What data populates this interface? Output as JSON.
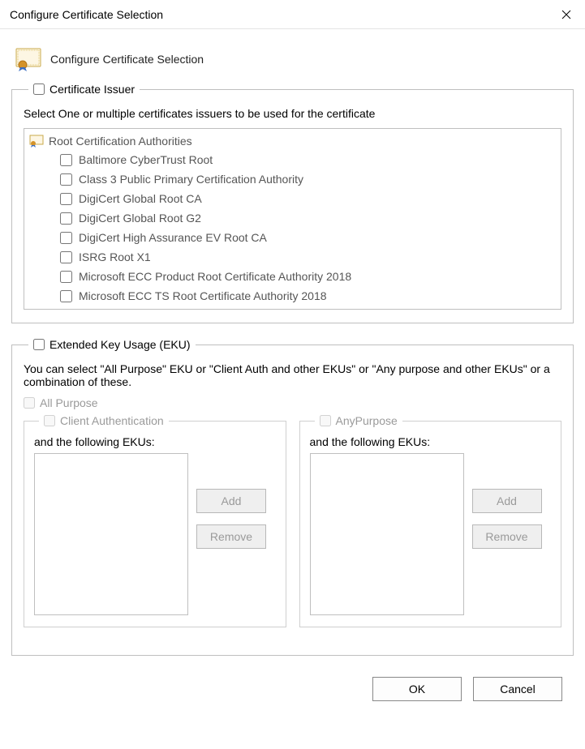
{
  "window": {
    "title": "Configure Certificate Selection"
  },
  "header": {
    "title": "Configure Certificate Selection"
  },
  "issuer": {
    "legend": "Certificate Issuer",
    "desc": "Select One or multiple certificates issuers to be used for the certificate",
    "root_label": "Root Certification Authorities",
    "items": [
      "Baltimore CyberTrust Root",
      "Class 3 Public Primary Certification Authority",
      "DigiCert Global Root CA",
      "DigiCert Global Root G2",
      "DigiCert High Assurance EV Root CA",
      "ISRG Root X1",
      "Microsoft ECC Product Root Certificate Authority 2018",
      "Microsoft ECC TS Root Certificate Authority 2018"
    ]
  },
  "eku": {
    "legend": "Extended Key Usage (EKU)",
    "desc": "You can select \"All Purpose\" EKU or \"Client Auth and other EKUs\" or \"Any purpose and other EKUs\" or a combination of these.",
    "all_purpose": "All Purpose",
    "client_auth": {
      "legend": "Client Authentication",
      "sub": "and the following EKUs:",
      "add": "Add",
      "remove": "Remove"
    },
    "any_purpose": {
      "legend": "AnyPurpose",
      "sub": "and the following EKUs:",
      "add": "Add",
      "remove": "Remove"
    }
  },
  "buttons": {
    "ok": "OK",
    "cancel": "Cancel"
  }
}
